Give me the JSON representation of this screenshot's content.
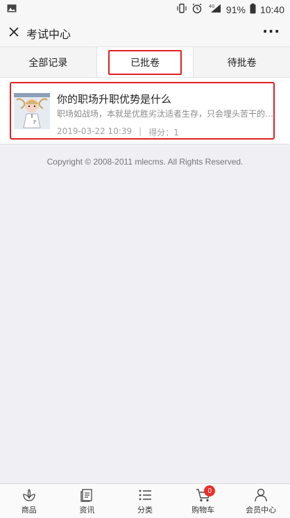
{
  "status_bar": {
    "battery": "91%",
    "time": "10:40",
    "network": "4G"
  },
  "header": {
    "title": "考试中心",
    "more_label": "···"
  },
  "tabs": [
    {
      "label": "全部记录"
    },
    {
      "label": "已批卷"
    },
    {
      "label": "待批卷"
    }
  ],
  "active_tab": 1,
  "records": [
    {
      "title": "你的职场升职优势是什么",
      "description": "职场如战场，本就是优胜劣汰适者生存，只会埋头苦干的人…",
      "date": "2019-03-22 10:39",
      "separator": "|",
      "score_label": "得分：1"
    }
  ],
  "copyright": "Copyright © 2008-2011 mlecms. All Rights Reserved.",
  "bottom_nav": [
    {
      "label": "商品",
      "icon": "flower-icon"
    },
    {
      "label": "资讯",
      "icon": "document-icon"
    },
    {
      "label": "分类",
      "icon": "list-icon"
    },
    {
      "label": "购物车",
      "icon": "cart-icon",
      "badge": "0"
    },
    {
      "label": "会员中心",
      "icon": "user-icon"
    }
  ],
  "colors": {
    "highlight": "#e02020",
    "badge": "#e8302a"
  }
}
